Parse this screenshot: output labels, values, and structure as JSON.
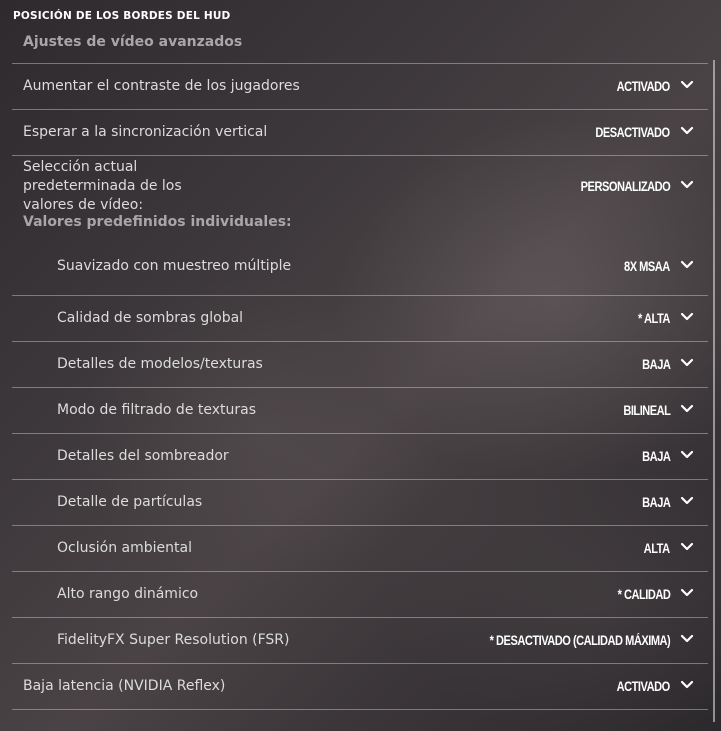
{
  "hud_title": "POSICIÓN DE LOS BORDES DEL HUD",
  "section_header": "Ajustes de vídeo avanzados",
  "rows_top": [
    {
      "label": "Aumentar el contraste de los jugadores",
      "value": "ACTIVADO"
    },
    {
      "label": "Esperar a la sincronización vertical",
      "value": "DESACTIVADO"
    }
  ],
  "preset_row": {
    "label": "Selección actual predeterminada de los valores de vídeo:",
    "value": "PERSONALIZADO",
    "sub_header": "Valores predefinidos individuales:"
  },
  "sub_rows": [
    {
      "label": "Suavizado con muestreo múltiple",
      "value": "8X MSAA"
    },
    {
      "label": "Calidad de sombras global",
      "value": "* ALTA"
    },
    {
      "label": "Detalles de modelos/texturas",
      "value": "BAJA"
    },
    {
      "label": "Modo de filtrado de texturas",
      "value": "BILINEAL"
    },
    {
      "label": "Detalles del sombreador",
      "value": "BAJA"
    },
    {
      "label": "Detalle de partículas",
      "value": "BAJA"
    },
    {
      "label": "Oclusión ambiental",
      "value": "ALTA"
    },
    {
      "label": "Alto rango dinámico",
      "value": "* CALIDAD"
    },
    {
      "label": "FidelityFX Super Resolution (FSR)",
      "value": "* DESACTIVADO (CALIDAD MÁXIMA)"
    }
  ],
  "rows_bottom": [
    {
      "label": "Baja latencia (NVIDIA Reflex)",
      "value": "ACTIVADO"
    }
  ],
  "icons": {
    "dropdown": "chevron-down-icon"
  }
}
